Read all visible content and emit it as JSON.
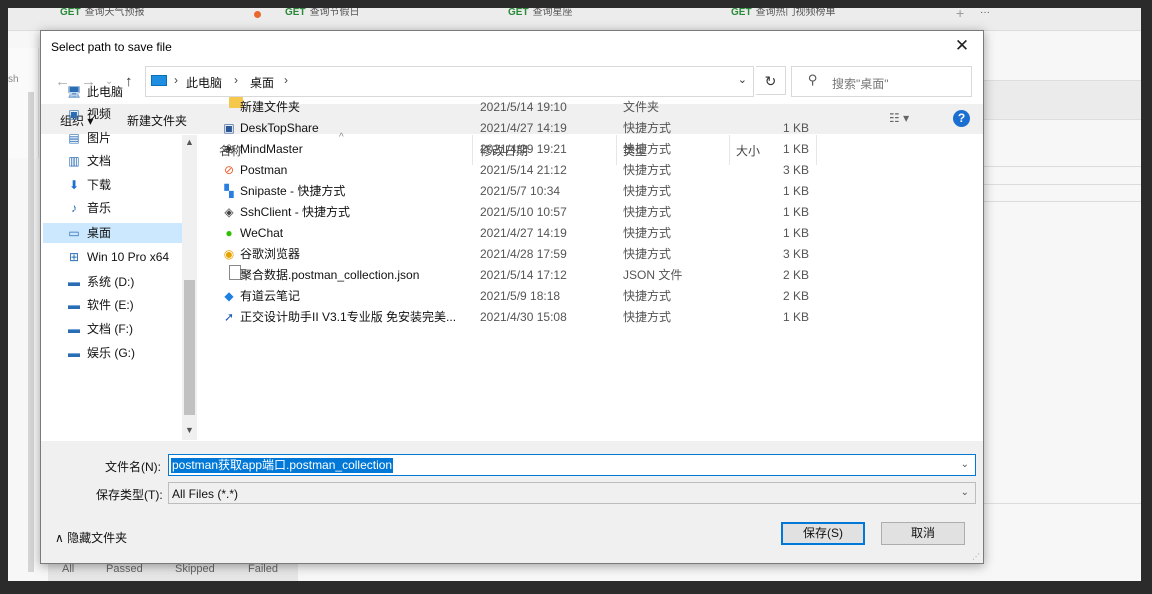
{
  "background": {
    "tabs": [
      {
        "method": "GET",
        "label": "查询天气预报"
      },
      {
        "method": "GET",
        "label": "查询节假日"
      },
      {
        "method": "GET",
        "label": "查询星座"
      },
      {
        "method": "GET",
        "label": "查询热门视频榜单"
      }
    ],
    "tab_plus": "+",
    "tab_more": "···",
    "left_text": "sh",
    "result_tabs": [
      "All",
      "Passed",
      "Skipped",
      "Failed"
    ]
  },
  "dialog": {
    "title": "Select path to save file",
    "close_glyph": "✕",
    "address": {
      "breadcrumbs": [
        "此电脑",
        "桌面"
      ],
      "separator": "›",
      "dropdown_glyph": "⌄",
      "refresh_glyph": "↻"
    },
    "nav_buttons": {
      "back": "←",
      "forward": "→",
      "recent": "⌄",
      "up": "↑"
    },
    "search": {
      "placeholder": "搜索\"桌面\"",
      "icon": "search-icon"
    },
    "toolbar": {
      "organize": "组织 ▾",
      "new_folder": "新建文件夹",
      "view": "☷ ▾",
      "help": "?"
    },
    "nav_pane": {
      "items": [
        {
          "label": "此电脑",
          "icon": "computer-icon",
          "glyph": "🖥"
        },
        {
          "label": "视频",
          "icon": "video-icon",
          "glyph": "▣"
        },
        {
          "label": "图片",
          "icon": "picture-icon",
          "glyph": "▤"
        },
        {
          "label": "文档",
          "icon": "document-icon",
          "glyph": "▥"
        },
        {
          "label": "下载",
          "icon": "download-icon",
          "glyph": "⬇"
        },
        {
          "label": "音乐",
          "icon": "music-icon",
          "glyph": "♪"
        },
        {
          "label": "桌面",
          "icon": "desktop-icon",
          "glyph": "▭",
          "selected": true
        },
        {
          "label": "Win 10 Pro x64",
          "icon": "network-drive-icon",
          "glyph": "⊞"
        },
        {
          "label": "系统 (D:)",
          "icon": "drive-icon",
          "glyph": "▬"
        },
        {
          "label": "软件 (E:)",
          "icon": "drive-icon",
          "glyph": "▬"
        },
        {
          "label": "文档 (F:)",
          "icon": "drive-icon",
          "glyph": "▬"
        },
        {
          "label": "娱乐 (G:)",
          "icon": "drive-icon",
          "glyph": "▬"
        }
      ]
    },
    "columns": {
      "name": "名称",
      "date": "修改日期",
      "type": "类型",
      "size": "大小",
      "sort_glyph": "^"
    },
    "files": [
      {
        "name": "新建文件夹",
        "date": "2021/5/14 19:10",
        "type": "文件夹",
        "size": "",
        "icon": "folder-icon",
        "glyph": "",
        "color": "#f5c84c"
      },
      {
        "name": "DeskTopShare",
        "date": "2021/4/27 14:19",
        "type": "快捷方式",
        "size": "1 KB",
        "icon": "desktopshare-icon",
        "glyph": "▣",
        "color": "#2b5797"
      },
      {
        "name": "MindMaster",
        "date": "2021/4/29 19:21",
        "type": "快捷方式",
        "size": "1 KB",
        "icon": "mindmaster-icon",
        "glyph": "❀",
        "color": "#333333"
      },
      {
        "name": "Postman",
        "date": "2021/5/14 21:12",
        "type": "快捷方式",
        "size": "3 KB",
        "icon": "postman-icon",
        "glyph": "⊘",
        "color": "#ef5b25"
      },
      {
        "name": "Snipaste - 快捷方式",
        "date": "2021/5/7 10:34",
        "type": "快捷方式",
        "size": "1 KB",
        "icon": "snipaste-icon",
        "glyph": "▚",
        "color": "#2a7de1"
      },
      {
        "name": "SshClient - 快捷方式",
        "date": "2021/5/10 10:57",
        "type": "快捷方式",
        "size": "1 KB",
        "icon": "sshclient-icon",
        "glyph": "◈",
        "color": "#444444"
      },
      {
        "name": "WeChat",
        "date": "2021/4/27 14:19",
        "type": "快捷方式",
        "size": "1 KB",
        "icon": "wechat-icon",
        "glyph": "●",
        "color": "#2dc100"
      },
      {
        "name": "谷歌浏览器",
        "date": "2021/4/28 17:59",
        "type": "快捷方式",
        "size": "3 KB",
        "icon": "chrome-icon",
        "glyph": "◉",
        "color": "#e8a200"
      },
      {
        "name": "聚合数据.postman_collection.json",
        "date": "2021/5/14 17:12",
        "type": "JSON 文件",
        "size": "2 KB",
        "icon": "json-file-icon",
        "glyph": "",
        "color": "#888888"
      },
      {
        "name": "有道云笔记",
        "date": "2021/5/9 18:18",
        "type": "快捷方式",
        "size": "2 KB",
        "icon": "youdao-note-icon",
        "glyph": "◆",
        "color": "#1e80e3"
      },
      {
        "name": "正交设计助手II V3.1专业版 免安装完美...",
        "date": "2021/4/30 15:08",
        "type": "快捷方式",
        "size": "1 KB",
        "icon": "orthogonal-icon",
        "glyph": "➚",
        "color": "#1e5fb3"
      }
    ],
    "filename_label": "文件名(N):",
    "filename_value": "postman获取app端口.postman_collection",
    "filetype_label": "保存类型(T):",
    "filetype_value": "All Files (*.*)",
    "hide_folders": "∧  隐藏文件夹",
    "save_button": "保存(S)",
    "cancel_button": "取消"
  }
}
